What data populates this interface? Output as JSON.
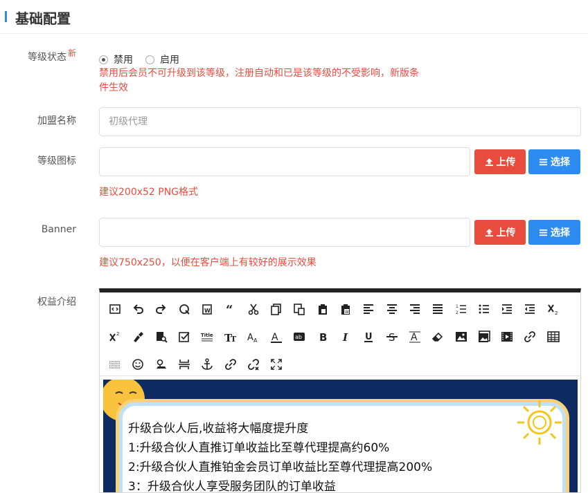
{
  "header": {
    "title": "基础配置"
  },
  "form": {
    "level_status": {
      "label": "等级状态",
      "new_badge": "新",
      "options": [
        "禁用",
        "启用"
      ],
      "selected": "禁用",
      "hint_line1": "禁用后会员不可升级到该等级，注册自动和已是该等级的不受影响，新版条",
      "hint_line2": "件生效"
    },
    "name": {
      "label": "加盟名称",
      "placeholder": "初级代理"
    },
    "icon": {
      "label": "等级图标",
      "value": "",
      "upload_label": "上传",
      "select_label": "选择",
      "hint": "建议200x52 PNG格式"
    },
    "banner": {
      "label": "Banner",
      "value": "",
      "upload_label": "上传",
      "select_label": "选择",
      "hint": "建议750x250，以便在客户端上有较好的展示效果"
    },
    "benefits": {
      "label": "权益介绍"
    }
  },
  "editor": {
    "toolbar": [
      [
        "source-icon",
        "undo-icon",
        "redo-icon",
        "blockquote-icon",
        "paste-word-icon",
        "quote-icon",
        "cut-icon",
        "copy-icon",
        "paste-icon",
        "paste-text-icon",
        "paste-format-icon",
        "align-left-icon",
        "align-center-icon",
        "align-right-icon",
        "align-justify-icon",
        "ordered-list-icon",
        "unordered-list-icon",
        "indent-icon",
        "outdent-icon",
        "subscript-icon"
      ],
      [
        "superscript-icon",
        "format-brush-icon",
        "find-replace-icon",
        "checkbox-icon",
        "title-icon",
        "font-family-icon",
        "font-size-icon",
        "font-color-icon",
        "background-color-icon",
        "bold-icon",
        "italic-icon",
        "underline-icon",
        "strikethrough-icon",
        "text-style-icon",
        "eraser-icon",
        "image-icon",
        "gallery-icon",
        "video-icon",
        "link-icon",
        "table-icon"
      ],
      [
        "horizontal-rule-icon",
        "emoji-icon",
        "map-icon",
        "page-break-icon",
        "anchor-icon",
        "link-alt-icon",
        "unlink-icon",
        "fullscreen-icon"
      ]
    ],
    "content_lines": [
      "升级合伙人后,收益将大幅度提升度",
      "1:升级合伙人直推订单收益比至尊代理提高约60%",
      "2:升级合伙人直推铂金会员订单收益比至尊代理提高200%",
      "3：升级合伙人享受服务团队的订单收益"
    ]
  },
  "colors": {
    "accent": "#2d8cf0",
    "danger": "#e74c3c",
    "hint": "#e74c3c"
  }
}
